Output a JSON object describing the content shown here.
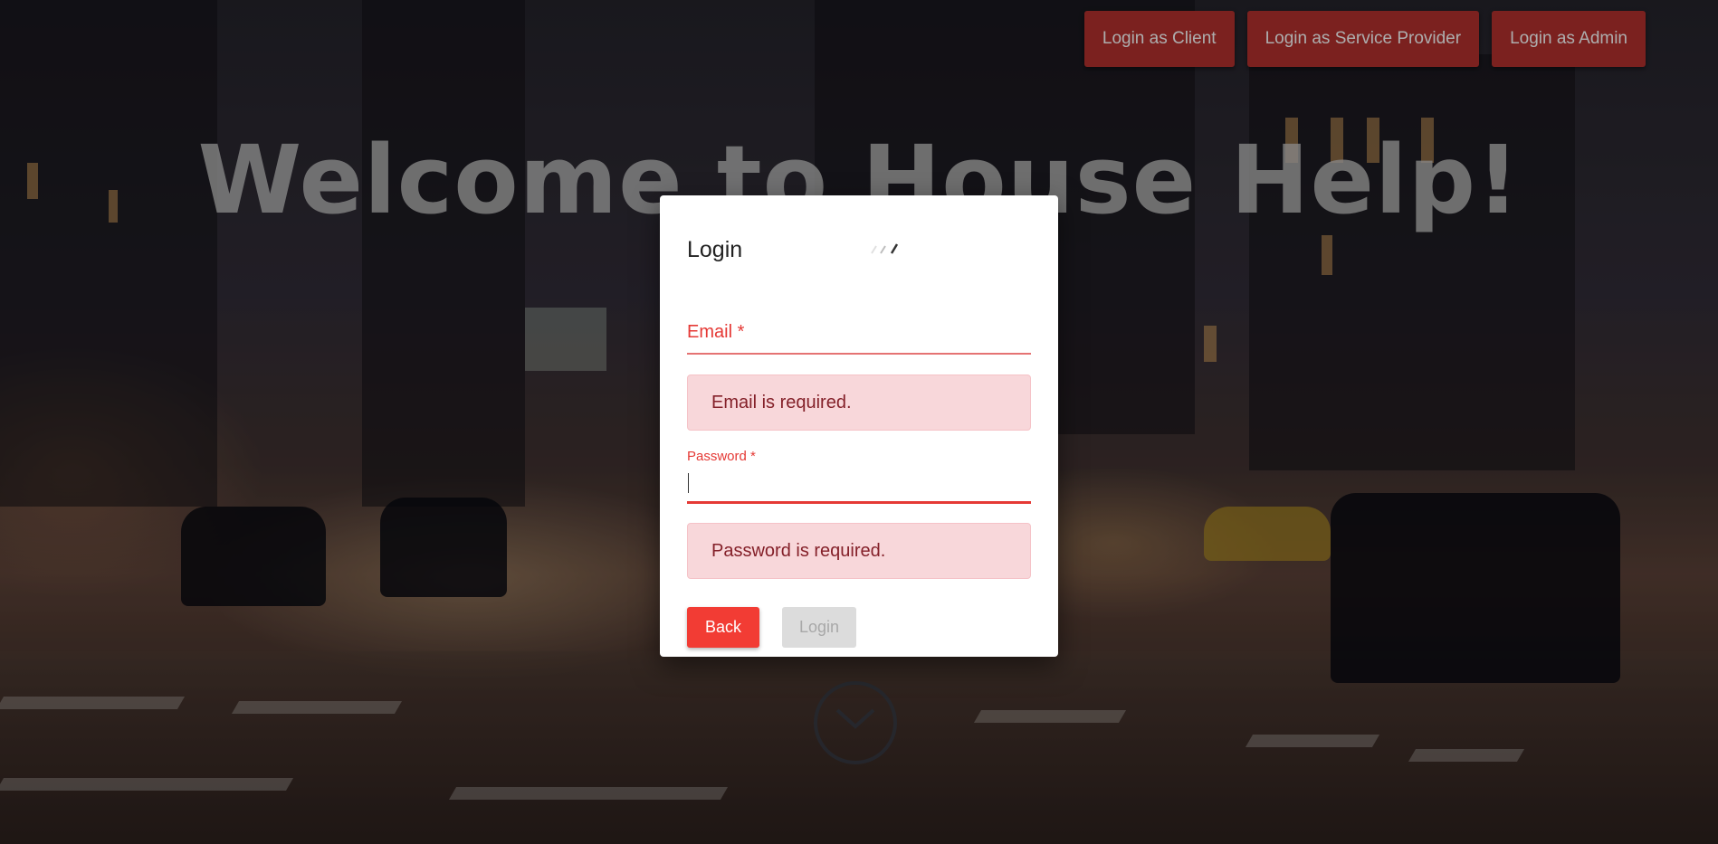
{
  "nav": {
    "client_label": "Login as Client",
    "provider_label": "Login as Service Provider",
    "admin_label": "Login as Admin"
  },
  "hero": {
    "title": "Welcome to House Help!"
  },
  "dialog": {
    "title": "Login",
    "email_label": "Email *",
    "email_error": "Email is required.",
    "password_label": "Password *",
    "password_value": "",
    "password_error": "Password is required.",
    "back_label": "Back",
    "login_label": "Login",
    "login_disabled": true
  },
  "colors": {
    "nav_button": "#b5322f",
    "back_button": "#f23c34",
    "error_text": "#e53935",
    "alert_bg": "#f8d7da"
  },
  "icons": {
    "scroll": "chevron-down-icon",
    "spinner": "loading-spinner-icon"
  }
}
